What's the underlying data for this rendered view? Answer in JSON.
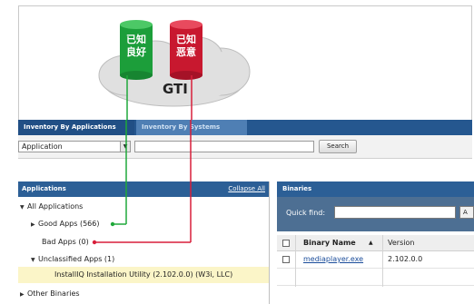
{
  "diagram": {
    "known_good_label": "已知良好",
    "known_bad_label": "已知恶意",
    "center_label": "GTI",
    "colors": {
      "good_line": "#1fa83a",
      "bad_line": "#d81f3a",
      "cloud": "#dedede"
    }
  },
  "tabs": [
    {
      "label": "Inventory By Applications",
      "active": true
    },
    {
      "label": "Inventory By Systems",
      "active": false
    }
  ],
  "toolbar": {
    "select_value": "Application",
    "search_value": "",
    "search_button": "Search"
  },
  "left_panel": {
    "title": "Applications",
    "collapse_all": "Collapse All",
    "tree": {
      "all_apps": "All Applications",
      "good_apps": "Good Apps (566)",
      "bad_apps": "Bad Apps (0)",
      "unclassified_apps": "Unclassified Apps (1)",
      "selected_app": "InstallIQ Installation Utility (2.102.0.0) (W3i, LLC)",
      "other_binaries": "Other Binaries"
    }
  },
  "right_panel": {
    "title": "Binaries",
    "quick_find_label": "Quick find:",
    "quick_find_value": "",
    "quick_find_button": "A",
    "columns": {
      "binary_name": "Binary Name",
      "sort_indicator": "▲",
      "version": "Version"
    },
    "rows": [
      {
        "binary_name": "mediaplayer.exe",
        "version": "2.102.0.0"
      }
    ]
  }
}
